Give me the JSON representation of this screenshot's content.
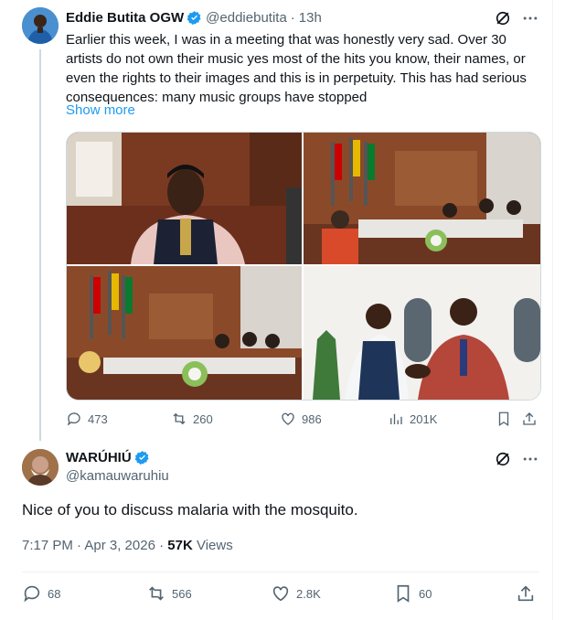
{
  "main_tweet": {
    "display_name": "Eddie Butita OGW",
    "handle": "@eddiebutita",
    "separator": "·",
    "time": "13h",
    "text": "Earlier this week, I was in a meeting that was honestly very sad. Over 30 artists do not own their music yes most of the hits you know, their names, or even the rights to their images and this is in perpetuity. This has had serious consequences: many music groups have stopped",
    "show_more": "Show more",
    "stats": {
      "replies": "473",
      "retweets": "260",
      "likes": "986",
      "views": "201K"
    }
  },
  "reply_tweet": {
    "display_name": "WARÚHIÚ",
    "handle": "@kamauwaruhiu",
    "text": "Nice of you to discuss malaria with the mosquito.",
    "timestamp": "7:17 PM · Apr 3, 2026 · ",
    "views_count": "57K",
    "views_label": " Views",
    "stats": {
      "replies": "68",
      "retweets": "566",
      "likes": "2.8K",
      "bookmarks": "60"
    }
  },
  "colors": {
    "accent": "#1d9bf0",
    "secondary_text": "#536471",
    "primary_text": "#0f1419"
  }
}
